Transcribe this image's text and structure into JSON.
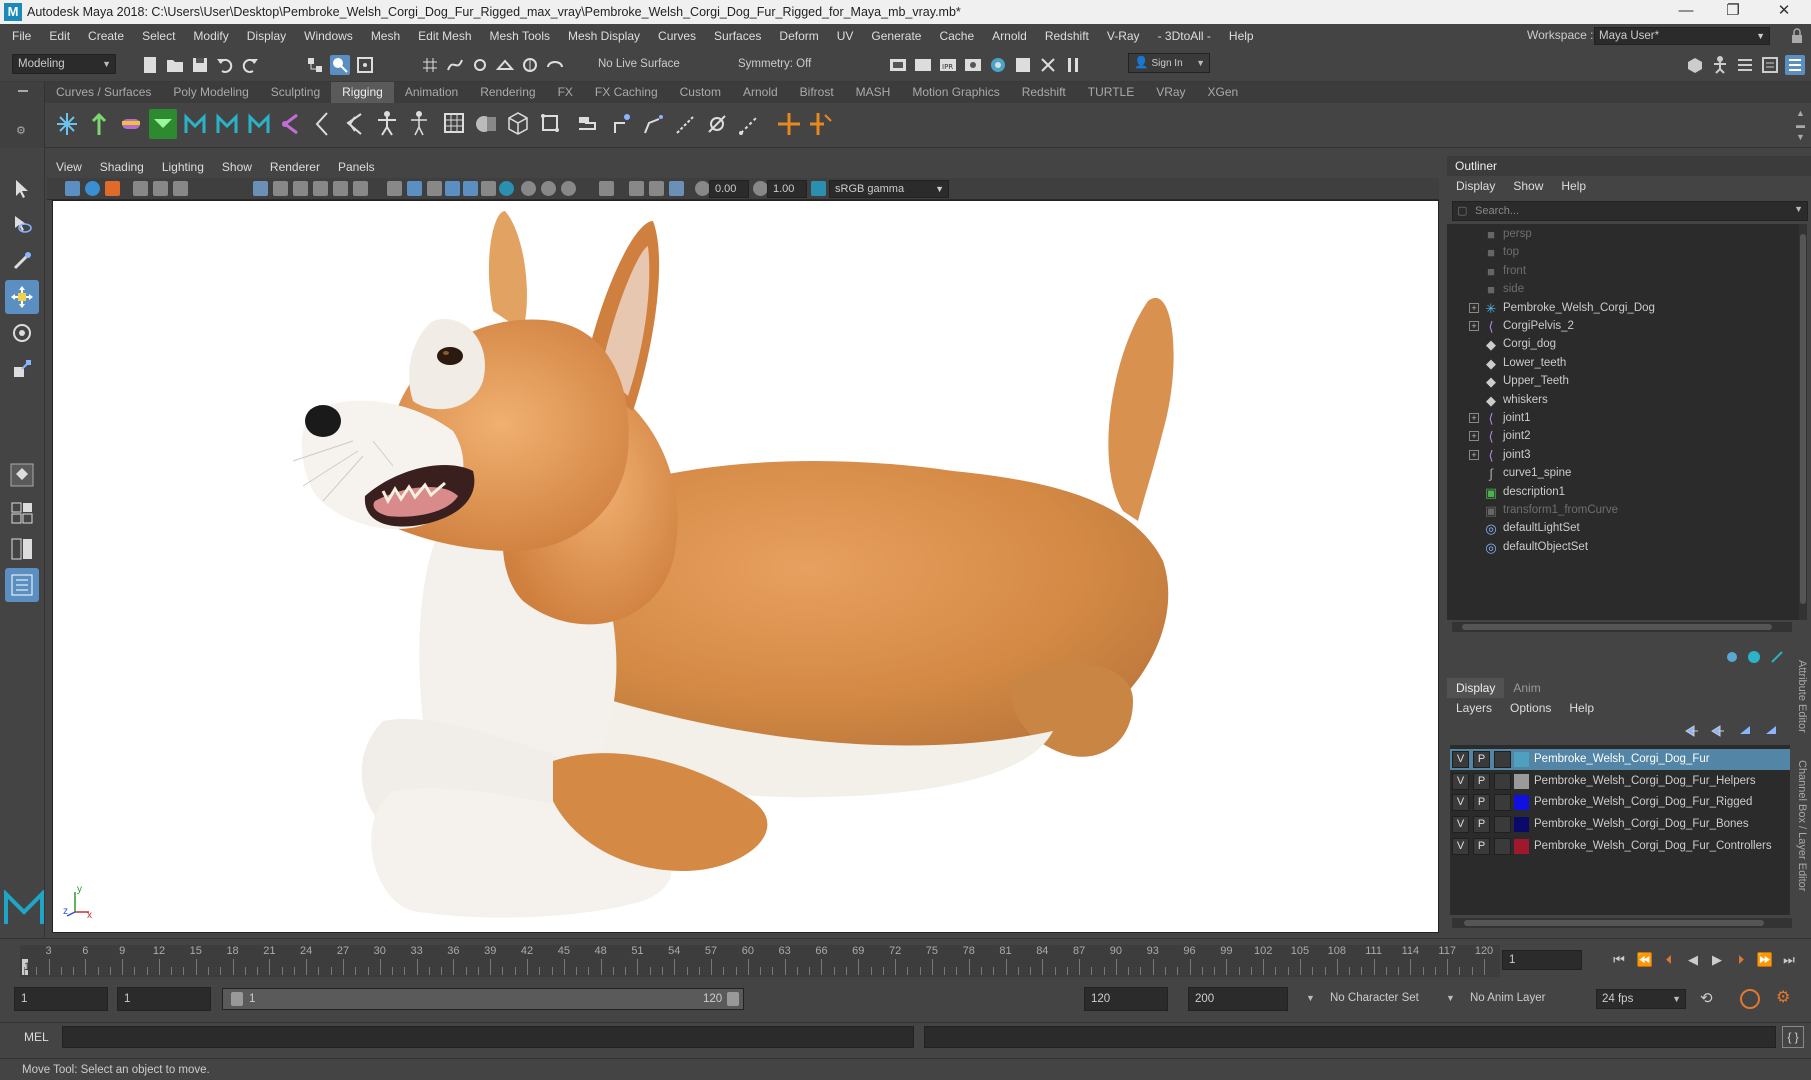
{
  "window": {
    "title": "Autodesk Maya 2018: C:\\Users\\User\\Desktop\\Pembroke_Welsh_Corgi_Dog_Fur_Rigged_max_vray\\Pembroke_Welsh_Corgi_Dog_Fur_Rigged_for_Maya_mb_vray.mb*",
    "logo_letter": "M",
    "controls": [
      "—",
      "❐",
      "✕"
    ]
  },
  "menubar": {
    "items": [
      "File",
      "Edit",
      "Create",
      "Select",
      "Modify",
      "Display",
      "Windows",
      "Mesh",
      "Edit Mesh",
      "Mesh Tools",
      "Mesh Display",
      "Curves",
      "Surfaces",
      "Deform",
      "UV",
      "Generate",
      "Cache",
      "Arnold",
      "Redshift",
      "V-Ray",
      "- 3DtoAll -",
      "Help"
    ],
    "workspace_label": "Workspace :",
    "workspace_value": "Maya User*"
  },
  "statusline": {
    "mode": "Modeling",
    "live_surface": "No Live Surface",
    "symmetry": "Symmetry: Off",
    "sign_in": "Sign In"
  },
  "shelf": {
    "tabs": [
      "Curves / Surfaces",
      "Poly Modeling",
      "Sculpting",
      "Rigging",
      "Animation",
      "Rendering",
      "FX",
      "FX Caching",
      "Custom",
      "Arnold",
      "Bifrost",
      "MASH",
      "Motion Graphics",
      "Redshift",
      "TURTLE",
      "VRay",
      "XGen"
    ],
    "active_tab": "Rigging"
  },
  "viewport": {
    "menu": [
      "View",
      "Shading",
      "Lighting",
      "Show",
      "Renderer",
      "Panels"
    ],
    "exposure": "0.00",
    "gamma": "1.00",
    "color_space": "sRGB gamma",
    "axis": {
      "x": "x",
      "y": "y",
      "z": "z"
    }
  },
  "outliner": {
    "title": "Outliner",
    "menu": [
      "Display",
      "Show",
      "Help"
    ],
    "search_placeholder": "Search...",
    "items": [
      {
        "label": "persp",
        "icon": "camera-icon",
        "dim": true,
        "expandable": false
      },
      {
        "label": "top",
        "icon": "camera-icon",
        "dim": true,
        "expandable": false
      },
      {
        "label": "front",
        "icon": "camera-icon",
        "dim": true,
        "expandable": false
      },
      {
        "label": "side",
        "icon": "camera-icon",
        "dim": true,
        "expandable": false
      },
      {
        "label": "Pembroke_Welsh_Corgi_Dog",
        "icon": "star-joint-icon",
        "dim": false,
        "expandable": true
      },
      {
        "label": "CorgiPelvis_2",
        "icon": "joint-icon",
        "dim": false,
        "expandable": true
      },
      {
        "label": "Corgi_dog",
        "icon": "mesh-icon",
        "dim": false,
        "expandable": false
      },
      {
        "label": "Lower_teeth",
        "icon": "mesh-icon",
        "dim": false,
        "expandable": false
      },
      {
        "label": "Upper_Teeth",
        "icon": "mesh-icon",
        "dim": false,
        "expandable": false
      },
      {
        "label": "whiskers",
        "icon": "mesh-icon",
        "dim": false,
        "expandable": false
      },
      {
        "label": "joint1",
        "icon": "joint-icon",
        "dim": false,
        "expandable": true
      },
      {
        "label": "joint2",
        "icon": "joint-icon",
        "dim": false,
        "expandable": true
      },
      {
        "label": "joint3",
        "icon": "joint-icon",
        "dim": false,
        "expandable": true
      },
      {
        "label": "curve1_spine",
        "icon": "curve-icon",
        "dim": false,
        "expandable": false
      },
      {
        "label": "description1",
        "icon": "xgen-icon",
        "dim": false,
        "expandable": false
      },
      {
        "label": "transform1_fromCurve",
        "icon": "xgen-icon",
        "dim": true,
        "expandable": false
      },
      {
        "label": "defaultLightSet",
        "icon": "set-icon",
        "dim": false,
        "expandable": false
      },
      {
        "label": "defaultObjectSet",
        "icon": "set-icon",
        "dim": false,
        "expandable": false
      }
    ]
  },
  "layers": {
    "tabs": [
      "Display",
      "Anim"
    ],
    "active_tab": "Display",
    "menu": [
      "Layers",
      "Options",
      "Help"
    ],
    "rows": [
      {
        "v": "V",
        "p": "P",
        "name": "Pembroke_Welsh_Corgi_Dog_Fur",
        "color": "#4f9fbf",
        "selected": true
      },
      {
        "v": "V",
        "p": "P",
        "name": "Pembroke_Welsh_Corgi_Dog_Fur_Helpers",
        "color": "#9a9a9a",
        "selected": false
      },
      {
        "v": "V",
        "p": "P",
        "name": "Pembroke_Welsh_Corgi_Dog_Fur_Rigged",
        "color": "#1010e0",
        "selected": false
      },
      {
        "v": "V",
        "p": "P",
        "name": "Pembroke_Welsh_Corgi_Dog_Fur_Bones",
        "color": "#0a0a6a",
        "selected": false
      },
      {
        "v": "V",
        "p": "P",
        "name": "Pembroke_Welsh_Corgi_Dog_Fur_Controllers",
        "color": "#a01830",
        "selected": false
      }
    ],
    "side_tabs": [
      "Attribute Editor",
      "Channel Box / Layer Editor"
    ]
  },
  "timeline": {
    "ticks": [
      "3",
      "6",
      "9",
      "12",
      "15",
      "18",
      "21",
      "24",
      "27",
      "30",
      "33",
      "36",
      "39",
      "42",
      "45",
      "48",
      "51",
      "54",
      "57",
      "60",
      "63",
      "66",
      "69",
      "72",
      "75",
      "78",
      "81",
      "84",
      "87",
      "90",
      "93",
      "96",
      "99",
      "102",
      "105",
      "108",
      "111",
      "114",
      "117",
      "120"
    ],
    "current_marker": "1",
    "current_frame": "1"
  },
  "range": {
    "start": "1",
    "playback_start": "1",
    "slider_start": "1",
    "slider_end": "120",
    "playback_end": "120",
    "end": "200",
    "character_set": "No Character Set",
    "anim_layer": "No Anim Layer",
    "fps": "24 fps"
  },
  "command": {
    "label": "MEL"
  },
  "helpline": "Move Tool: Select an object to move."
}
